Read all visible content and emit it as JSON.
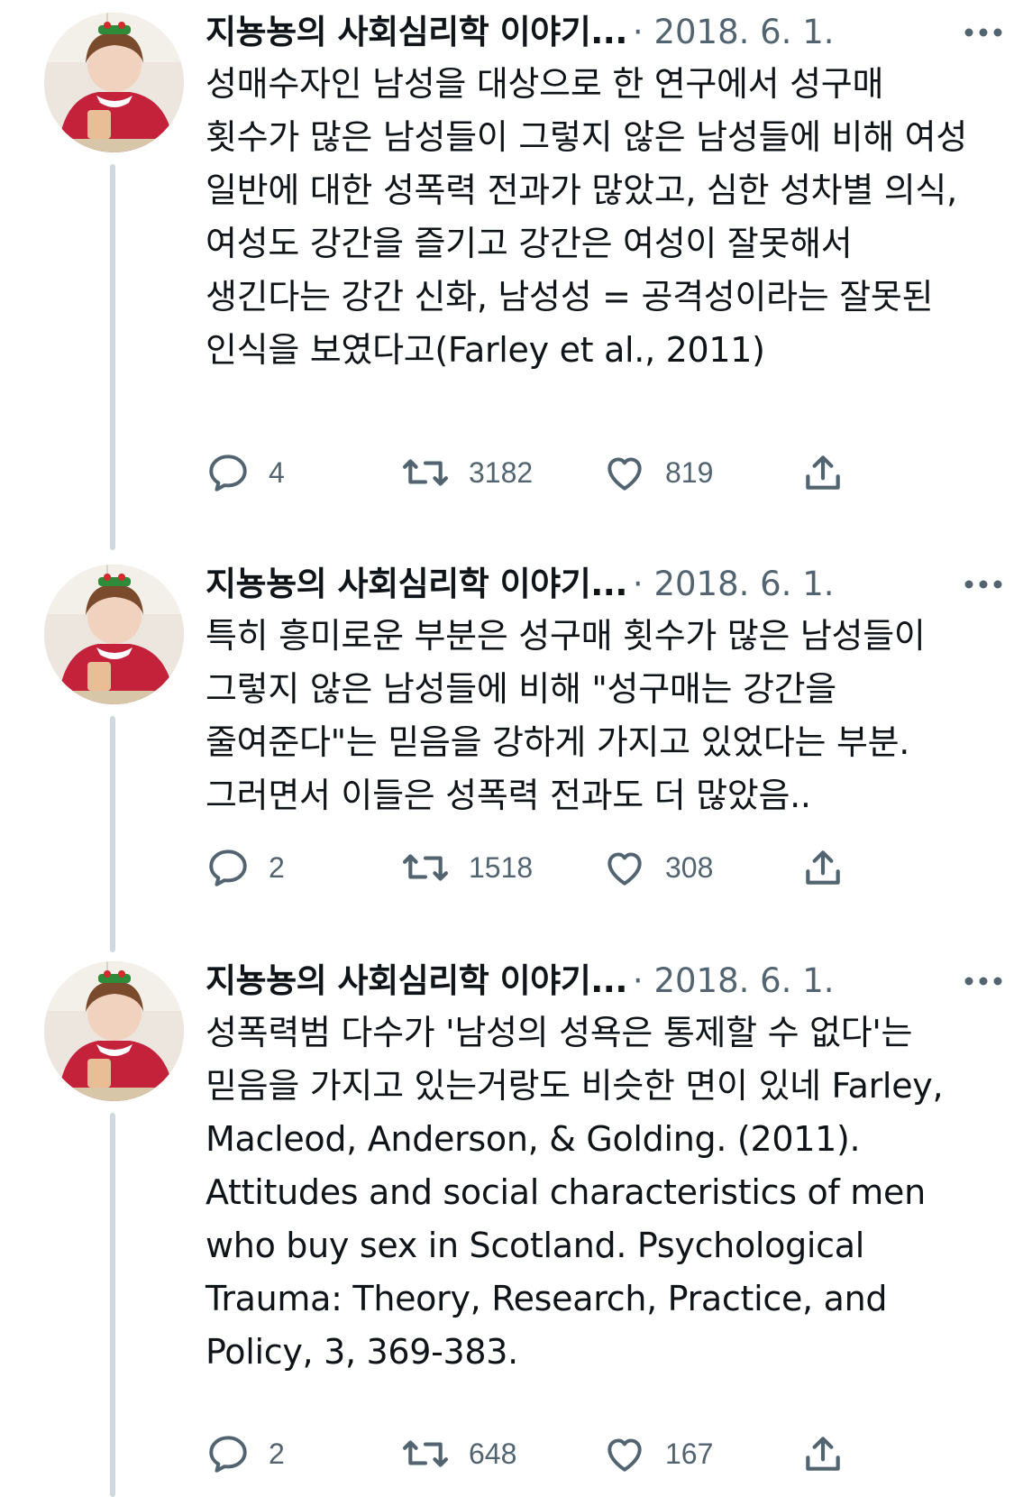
{
  "tweets": [
    {
      "author": "지뇽뇽의 사회심리학 이야기...",
      "date": "· 2018. 6. 1.",
      "text": "성매수자인 남성을 대상으로 한 연구에서 성구매 횟수가 많은 남성들이 그렇지 않은 남성들에 비해 여성 일반에 대한 성폭력 전과가 많았고, 심한 성차별 의식, 여성도 강간을 즐기고 강간은 여성이 잘못해서 생긴다는 강간 신화, 남성성 = 공격성이라는 잘못된 인식을 보였다고(Farley et al., 2011)",
      "replies": "4",
      "retweets": "3182",
      "likes": "819"
    },
    {
      "author": "지뇽뇽의 사회심리학 이야기...",
      "date": "· 2018. 6. 1.",
      "text": "특히 흥미로운 부분은 성구매 횟수가 많은 남성들이 그렇지 않은 남성들에 비해 \"성구매는 강간을 줄여준다\"는 믿음을 강하게 가지고 있었다는 부분. 그러면서 이들은 성폭력 전과도 더 많았음..",
      "replies": "2",
      "retweets": "1518",
      "likes": "308"
    },
    {
      "author": "지뇽뇽의 사회심리학 이야기...",
      "date": "· 2018. 6. 1.",
      "text": "성폭력범 다수가 '남성의 성욕은 통제할 수 없다'는 믿음을 가지고 있는거랑도 비슷한 면이 있네 Farley, Macleod, Anderson, & Golding. (2011). Attitudes and social characteristics of men who buy sex in Scotland. Psychological Trauma: Theory, Research, Practice, and Policy, 3, 369-383.",
      "replies": "2",
      "retweets": "648",
      "likes": "167"
    }
  ],
  "icons": {
    "reply": "speech-bubble-icon",
    "retweet": "retweet-arrows-icon",
    "like": "heart-outline-icon",
    "share": "share-upload-icon",
    "more": "more-dots-icon"
  },
  "colors": {
    "text": "#0f1419",
    "secondary": "#536471",
    "thread_line": "#cfd9de",
    "avatar_sweater": "#c4213a"
  }
}
